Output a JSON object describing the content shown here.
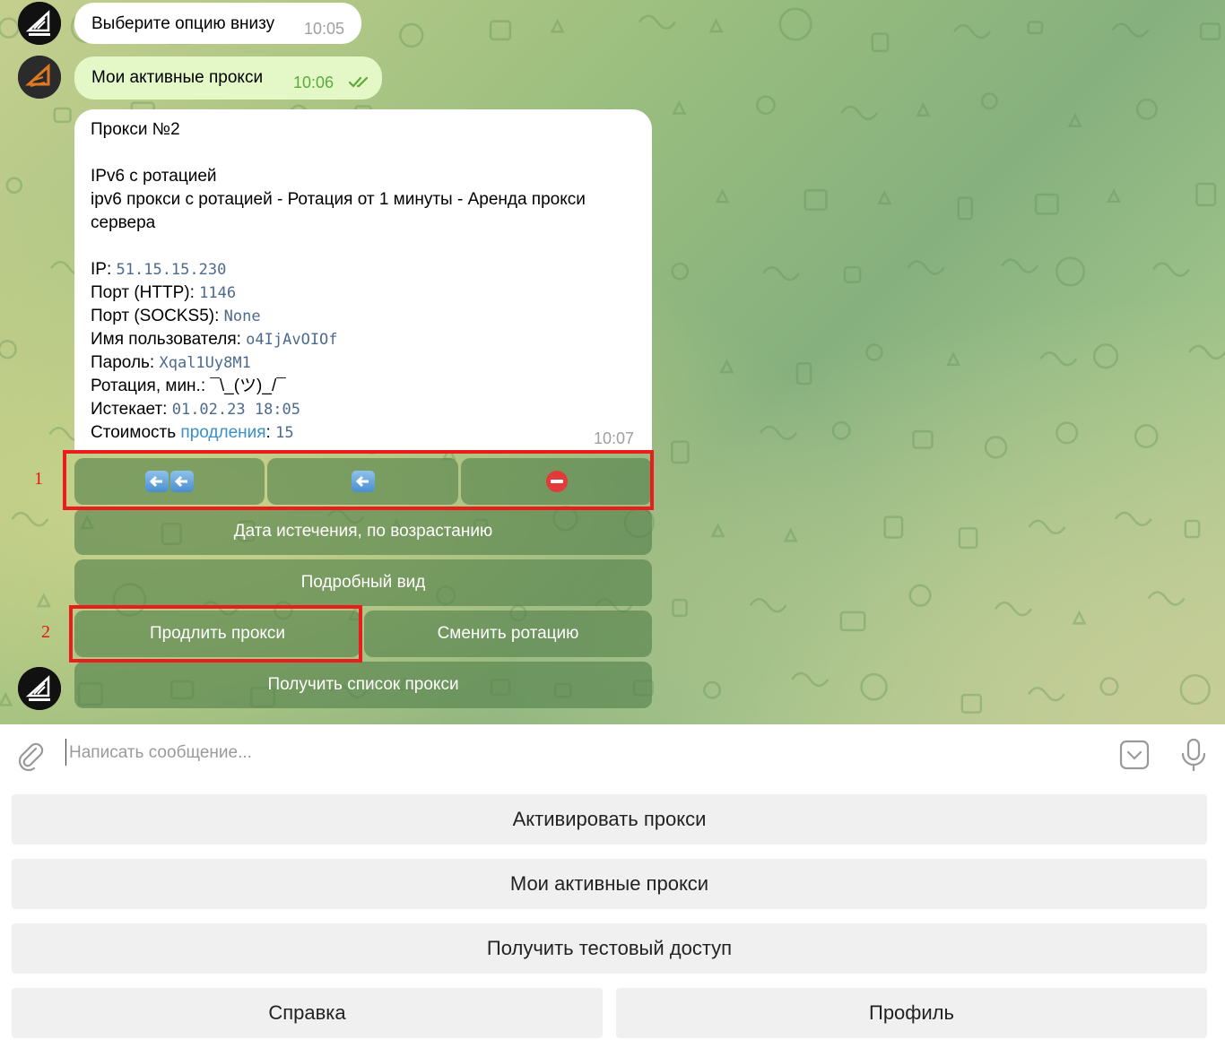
{
  "messages": {
    "first": {
      "text": "Выберите опцию внизу",
      "time": "10:05"
    },
    "second": {
      "text": "Мои активные прокси",
      "time": "10:06"
    }
  },
  "proxy_card": {
    "title": "Прокси №2",
    "type": "IPv6 с ротацией",
    "description_line1": "ipv6 прокси с ротацией - Ротация от 1 минуты - Аренда прокси",
    "description_line2": "сервера",
    "ip_label": "IP: ",
    "ip_value": "51.15.15.230",
    "http_port_label": "Порт (HTTP): ",
    "http_port_value": "1146",
    "socks_port_label": "Порт (SOCKS5): ",
    "socks_port_value": "None",
    "username_label": "Имя пользователя: ",
    "username_value": "o4IjAvOIOf",
    "password_label": "Пароль: ",
    "password_value": "Xqal1Uy8M1",
    "rotation_label": "Ротация, мин.: ",
    "rotation_value": "¯\\_(ツ)_/¯",
    "expires_label": "Истекает: ",
    "expires_value": "01.02.23 18:05",
    "cost_label": "Стоимость ",
    "cost_link": "продления",
    "cost_separator": ": ",
    "cost_value": "15",
    "time": "10:07"
  },
  "inline_keyboard": {
    "row1_icons": [
      "double-left-arrow-icon",
      "left-arrow-icon",
      "no-entry-icon"
    ],
    "sort_button": "Дата истечения, по возрастанию",
    "detail_button": "Подробный вид",
    "extend_button": "Продлить прокси",
    "rotation_button": "Сменить ротацию",
    "list_button": "Получить список прокси"
  },
  "annotations": {
    "marker_1": "1",
    "marker_2": "2",
    "color": "#ea1c1c"
  },
  "composer": {
    "placeholder": "Написать сообщение..."
  },
  "reply_keyboard": {
    "activate": "Активировать прокси",
    "my_active": "Мои активные прокси",
    "test_access": "Получить тестовый доступ",
    "help": "Справка",
    "profile": "Профиль"
  },
  "colors": {
    "chat_bg": "#9cbf7f",
    "outgoing_bubble": "#e3f8c6",
    "inline_button": "#52804a",
    "link": "#3a90c8"
  }
}
